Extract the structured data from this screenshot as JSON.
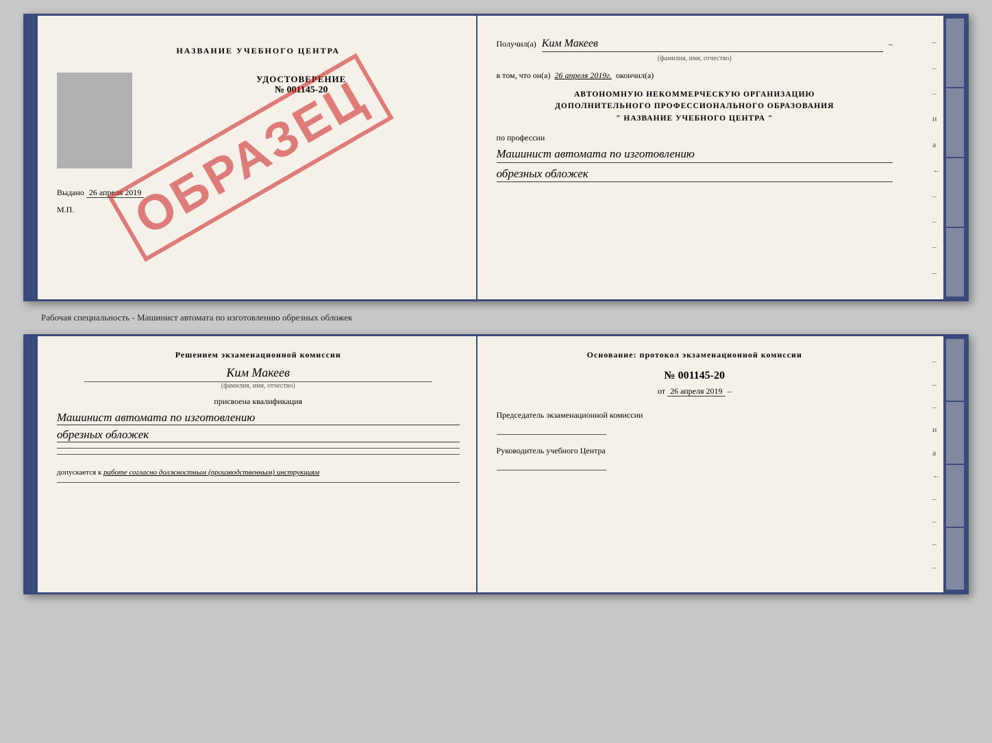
{
  "top_doc": {
    "left": {
      "center_title": "НАЗВАНИЕ УЧЕБНОГО ЦЕНТРА",
      "udostoverenie_label": "УДОСТОВЕРЕНИЕ",
      "number": "№ 001145-20",
      "vydano_label": "Выдано",
      "vydano_date": "26 апреля 2019",
      "mp_label": "М.П.",
      "obrazec": "ОБРАЗЕЦ"
    },
    "right": {
      "poluchil_label": "Получил(а)",
      "poluchil_name": "Ким Макеев",
      "fio_sub": "(фамилия, имя, отчество)",
      "vtom_label": "в том, что он(а)",
      "vtom_date": "26 апреля 2019г.",
      "okonchil_label": "окончил(а)",
      "org_line1": "АВТОНОМНУЮ НЕКОММЕРЧЕСКУЮ ОРГАНИЗАЦИЮ",
      "org_line2": "ДОПОЛНИТЕЛЬНОГО ПРОФЕССИОНАЛЬНОГО ОБРАЗОВАНИЯ",
      "org_line3": "\"   НАЗВАНИЕ УЧЕБНОГО ЦЕНТРА   \"",
      "po_professii": "по профессии",
      "profession_line1": "Машинист автомата по изготовлению",
      "profession_line2": "обрезных обложек"
    }
  },
  "separator": {
    "text": "Рабочая специальность - Машинист автомата по изготовлению обрезных обложек"
  },
  "bottom_doc": {
    "left": {
      "resheniem_label": "Решением экзаменационной комиссии",
      "name": "Ким Макеев",
      "fio_sub": "(фамилия, имя, отчество)",
      "prisvoena_label": "присвоена квалификация",
      "qualification_line1": "Машинист автомата по изготовлению",
      "qualification_line2": "обрезных обложек",
      "dopuskaetsya_label": "допускается к",
      "dopuskaetsya_text": "работе согласно должностным (производственным) инструкциям"
    },
    "right": {
      "osnovanie_label": "Основание: протокол экзаменационной комиссии",
      "protocol_num": "№  001145-20",
      "ot_label": "от",
      "ot_date": "26 апреля 2019",
      "predsedatel_label": "Председатель экзаменационной комиссии",
      "rukovoditel_label": "Руководитель учебного Центра"
    }
  }
}
